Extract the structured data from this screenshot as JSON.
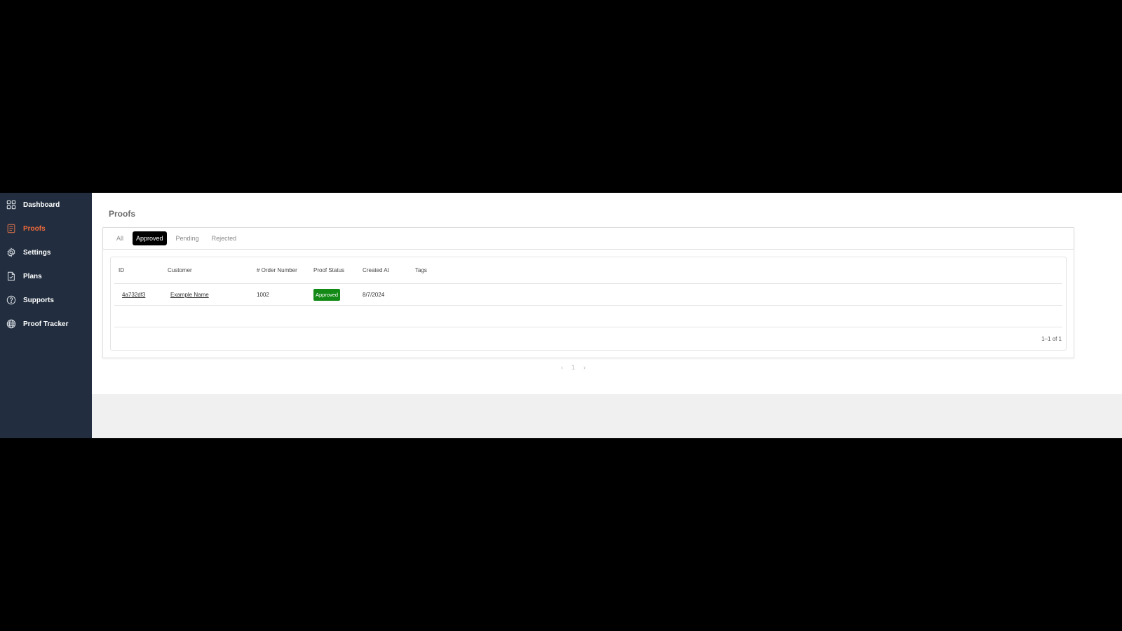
{
  "sidebar": {
    "items": [
      {
        "label": "Dashboard",
        "icon": "dashboard-grid-icon",
        "active": false
      },
      {
        "label": "Proofs",
        "icon": "document-icon",
        "active": true
      },
      {
        "label": "Settings",
        "icon": "gear-icon",
        "active": false
      },
      {
        "label": "Plans",
        "icon": "file-check-icon",
        "active": false
      },
      {
        "label": "Supports",
        "icon": "help-circle-icon",
        "active": false
      },
      {
        "label": "Proof Tracker",
        "icon": "globe-icon",
        "active": false
      }
    ]
  },
  "page": {
    "title": "Proofs"
  },
  "tabs": [
    {
      "label": "All",
      "active": false
    },
    {
      "label": "Approved",
      "active": true
    },
    {
      "label": "Pending",
      "active": false
    },
    {
      "label": "Rejected",
      "active": false
    }
  ],
  "table": {
    "columns": [
      "ID",
      "Customer",
      "# Order Number",
      "Proof Status",
      "Created At",
      "Tags"
    ],
    "rows": [
      {
        "id": "4a732df3",
        "customer": "Example Name",
        "order_number": "1002",
        "status": "Approved",
        "created_at": "8/7/2024",
        "tags": ""
      }
    ],
    "footer": "1–1 of 1"
  },
  "pagination": {
    "prev": "‹",
    "current": "1",
    "next": "›"
  },
  "colors": {
    "sidebar_bg": "#222e3f",
    "active_accent": "#f26a3a",
    "approved_badge": "#138a16"
  }
}
